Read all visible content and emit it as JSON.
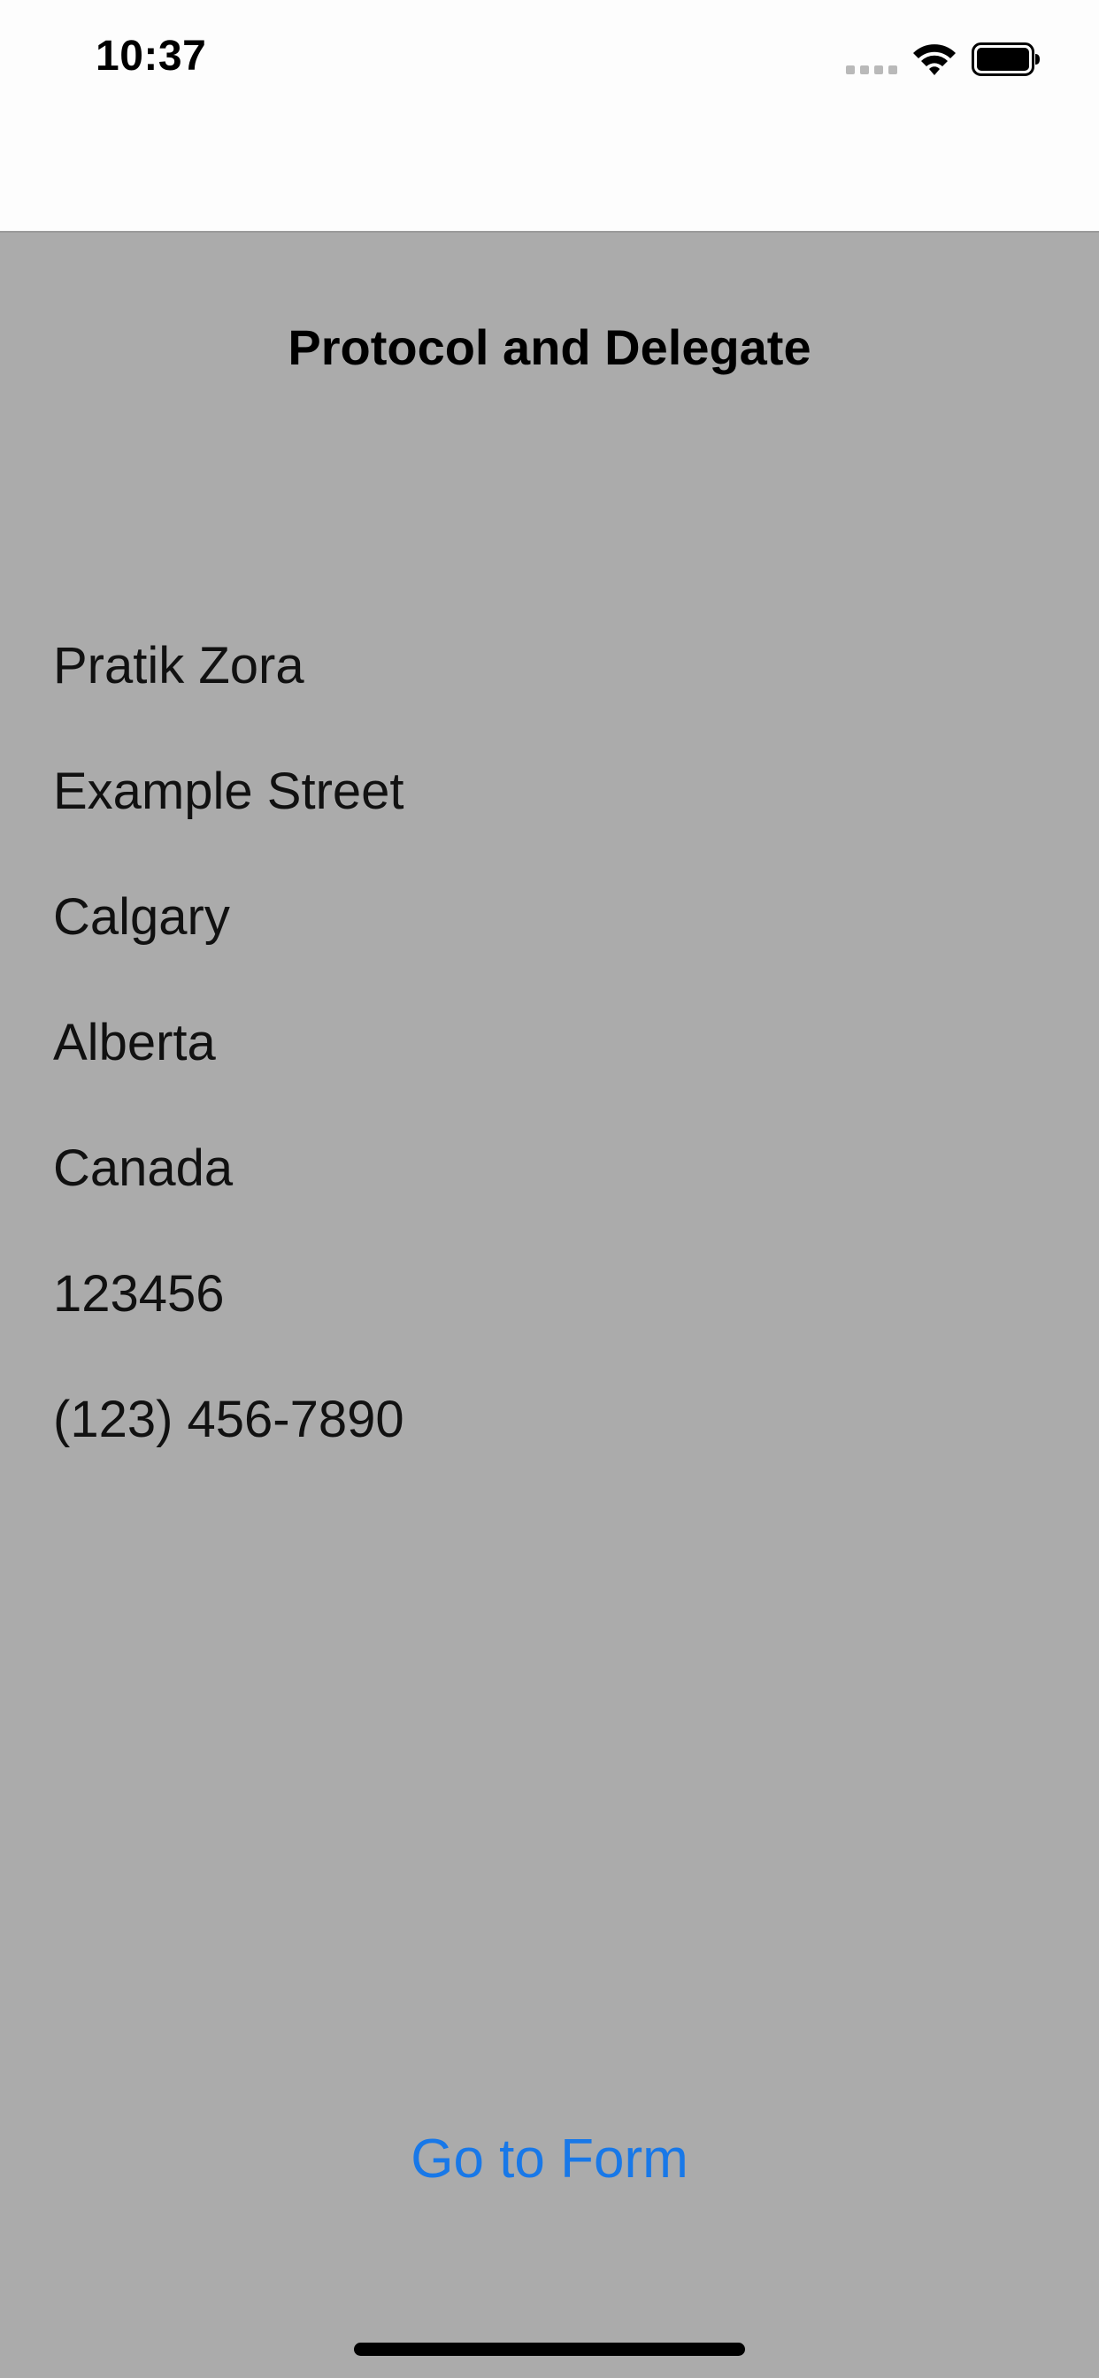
{
  "status_bar": {
    "time": "10:37",
    "icons": [
      "cellular-signal-icon",
      "wifi-icon",
      "battery-icon"
    ]
  },
  "navigation": {
    "title": "Protocol and Delegate"
  },
  "contact_info": {
    "name": "Pratik Zora",
    "street": "Example Street",
    "city": "Calgary",
    "province": "Alberta",
    "country": "Canada",
    "postal_code": "123456",
    "phone": "(123) 456-7890"
  },
  "actions": {
    "go_to_form_label": "Go to Form"
  },
  "colors": {
    "background": "#ababab",
    "status_bar_background": "#fdfdfd",
    "accent": "#1878e8",
    "text": "#000000"
  }
}
